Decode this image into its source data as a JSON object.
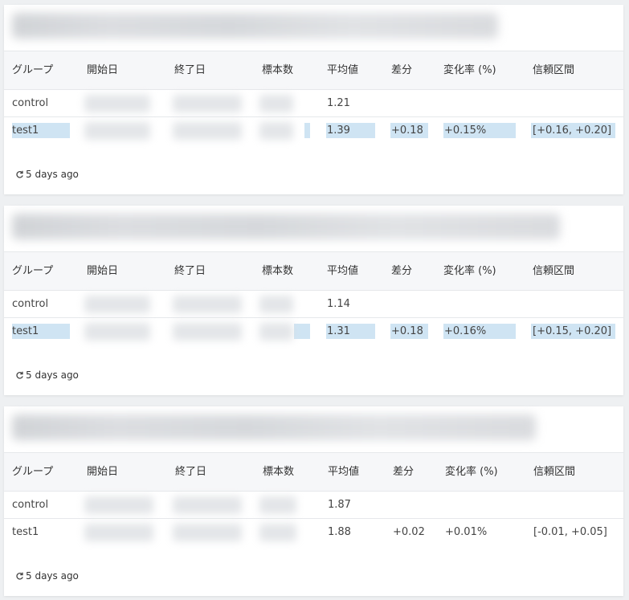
{
  "columns": [
    "グループ",
    "開始日",
    "終了日",
    "標本数",
    "平均値",
    "差分",
    "変化率 (%)",
    "信頼区間"
  ],
  "highlight_color": "#cfe4f3",
  "cards": [
    {
      "rows": [
        {
          "group": "control",
          "mean": "1.21",
          "diff": "",
          "rate": "",
          "ci": ""
        },
        {
          "group": "test1",
          "mean": "1.39",
          "diff": "+0.18",
          "rate": "+0.15%",
          "ci": "[+0.16, +0.20]"
        }
      ],
      "updated": "5 days ago"
    },
    {
      "rows": [
        {
          "group": "control",
          "mean": "1.14",
          "diff": "",
          "rate": "",
          "ci": ""
        },
        {
          "group": "test1",
          "mean": "1.31",
          "diff": "+0.18",
          "rate": "+0.16%",
          "ci": "[+0.15, +0.20]"
        }
      ],
      "updated": "5 days ago"
    },
    {
      "rows": [
        {
          "group": "control",
          "mean": "1.87",
          "diff": "",
          "rate": "",
          "ci": ""
        },
        {
          "group": "test1",
          "mean": "1.88",
          "diff": "+0.02",
          "rate": "+0.01%",
          "ci": "[-0.01, +0.05]"
        }
      ],
      "updated": "5 days ago"
    }
  ]
}
